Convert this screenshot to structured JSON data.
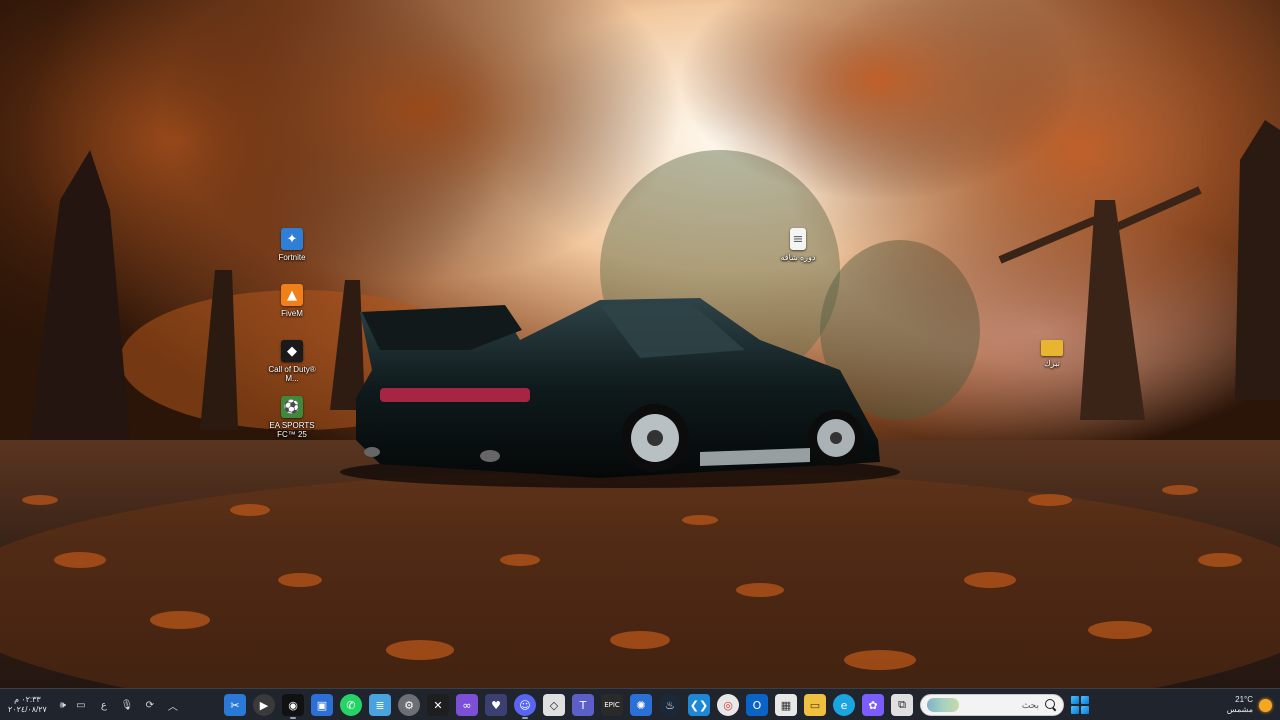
{
  "desktop": {
    "icons": [
      {
        "label": "Fortnite",
        "icon": "fortnite-icon",
        "color": "#2f7fd6"
      },
      {
        "label": "FiveM",
        "icon": "fivem-icon",
        "color": "#f0801a"
      },
      {
        "label": "Call of Duty® M...",
        "icon": "call-of-duty-icon",
        "color": "#1a1a1a"
      },
      {
        "label": "EA SPORTS FC™ 25",
        "icon": "ea-sports-fc-icon",
        "color": "#3e8a3a"
      },
      {
        "label": "دوره شاقه",
        "icon": "text-document-icon",
        "color": "#f4f4f4"
      },
      {
        "label": "تبرك",
        "icon": "folder-icon",
        "color": "#e8b530"
      }
    ]
  },
  "taskbar": {
    "weather": {
      "temp": "21°C",
      "condition": "مشمس",
      "icon": "sun-icon"
    },
    "search": {
      "placeholder": "بحث"
    },
    "clock": {
      "time": "٠٢:٣٣ م",
      "date": "٢٠٢٤/٠٨/٢٧"
    },
    "keyboard_lang": "ع",
    "apps": [
      {
        "name": "Snipping Tool",
        "icon": "snipping-tool-icon",
        "color": "#2b79d6"
      },
      {
        "name": "Media Player",
        "icon": "media-player-icon",
        "color": "#3a3a3a"
      },
      {
        "name": "Call of Duty",
        "icon": "call-of-duty-taskbar-icon",
        "color": "#111111"
      },
      {
        "name": "Phone Link",
        "icon": "phone-link-icon",
        "color": "#2c6fd6"
      },
      {
        "name": "WhatsApp",
        "icon": "whatsapp-icon",
        "color": "#25d366"
      },
      {
        "name": "Notepad",
        "icon": "notepad-icon",
        "color": "#4aa3df"
      },
      {
        "name": "Settings",
        "icon": "settings-icon",
        "color": "#6c6f76"
      },
      {
        "name": "Xbox",
        "icon": "xbox-icon",
        "color": "#1e1e1e"
      },
      {
        "name": "Visual Studio",
        "icon": "visual-studio-icon",
        "color": "#7b4fd6"
      },
      {
        "name": "Vencord",
        "icon": "vencord-icon",
        "color": "#3b3f72"
      },
      {
        "name": "Discord",
        "icon": "discord-icon",
        "color": "#5865f2"
      },
      {
        "name": "Unity",
        "icon": "unity-icon",
        "color": "#e0e0e0"
      },
      {
        "name": "Teams",
        "icon": "teams-icon",
        "color": "#5b5fc7"
      },
      {
        "name": "Epic Games",
        "icon": "epic-games-icon",
        "color": "#2a2a2a"
      },
      {
        "name": "Battle Net",
        "icon": "battlenet-icon",
        "color": "#2c6fd6"
      },
      {
        "name": "Steam",
        "icon": "steam-icon",
        "color": "#1b2838"
      },
      {
        "name": "VS Code",
        "icon": "vscode-icon",
        "color": "#1e88d6"
      },
      {
        "name": "Chrome",
        "icon": "chrome-icon",
        "color": "#e8e8e8"
      },
      {
        "name": "Outlook",
        "icon": "outlook-icon",
        "color": "#0a64c8"
      },
      {
        "name": "Store",
        "icon": "store-icon",
        "color": "#e8e8e8"
      },
      {
        "name": "File Explorer",
        "icon": "file-explorer-icon",
        "color": "#f0c040"
      },
      {
        "name": "Edge",
        "icon": "edge-icon",
        "color": "#1aa4e0"
      },
      {
        "name": "Copilot",
        "icon": "copilot-icon",
        "color": "#7b5cff"
      },
      {
        "name": "Task View",
        "icon": "task-view-icon",
        "color": "#e0e0e0"
      }
    ]
  }
}
